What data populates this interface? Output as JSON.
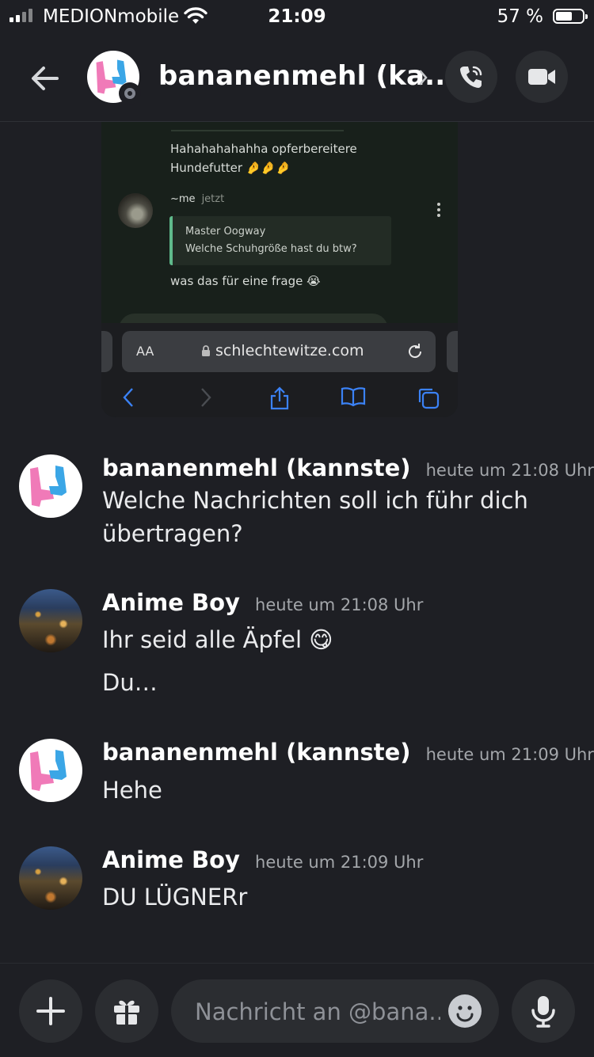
{
  "status_bar": {
    "carrier": "MEDIONmobile",
    "time": "21:09",
    "battery_pct": "57 %"
  },
  "header": {
    "title": "bananenmehl (ka...",
    "icons": {
      "back": "arrow-left-icon",
      "call": "phone-icon",
      "video": "video-camera-icon",
      "chevron": "chevron-right-icon"
    }
  },
  "embedded_screenshot": {
    "message_1": "Hahahahahahha opferbereitere Hundefutter 🤌🤌🤌",
    "author": "~me",
    "author_time": "jetzt",
    "quote_author": "Master Oogway",
    "quote_text": "Welche Schuhgröße hast du btw?",
    "message_2": "was das für eine frage 😭",
    "text_size_label": "AA",
    "url": "schlechtewitze.com"
  },
  "messages": [
    {
      "author": "bananenmehl (kannste)",
      "time": "heute um 21:08 Uhr",
      "lines": [
        "Welche Nachrichten soll ich führ dich übertragen?"
      ]
    },
    {
      "author": "Anime Boy",
      "time": "heute um 21:08 Uhr",
      "lines": [
        "Ihr seid alle Äpfel 😋",
        "Du…"
      ]
    },
    {
      "author": "bananenmehl (kannste)",
      "time": "heute um 21:09 Uhr",
      "lines": [
        "Hehe"
      ]
    },
    {
      "author": "Anime Boy",
      "time": "heute um 21:09 Uhr",
      "lines": [
        "DU LÜGNERr"
      ]
    }
  ],
  "composer": {
    "placeholder": "Nachricht an @bana...",
    "icons": {
      "add": "plus-icon",
      "gift": "gift-icon",
      "emoji": "emoji-icon",
      "mic": "microphone-icon"
    }
  },
  "colors": {
    "background": "#1e1f24",
    "button_bg": "#2b2d31",
    "timestamp": "#a3a6aa",
    "ios_link_blue": "#3b82f6"
  }
}
